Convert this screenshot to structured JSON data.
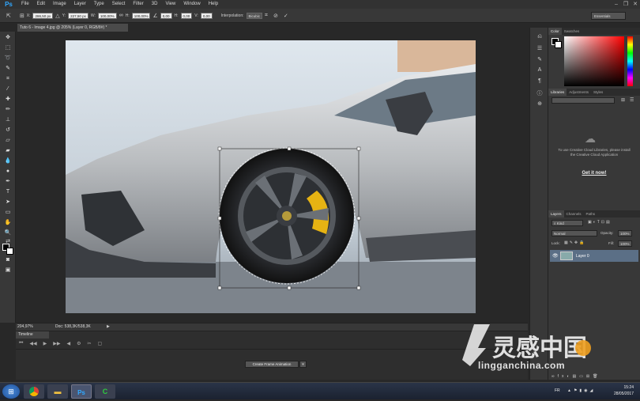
{
  "app": {
    "logo": "Ps"
  },
  "menu": [
    "File",
    "Edit",
    "Image",
    "Layer",
    "Type",
    "Select",
    "Filter",
    "3D",
    "View",
    "Window",
    "Help"
  ],
  "window_controls": [
    "–",
    "❐",
    "✕"
  ],
  "options_bar": {
    "x_label": "X:",
    "x_value": "286,50 px",
    "y_label": "Y:",
    "y_value": "227,50 px",
    "w_label": "W:",
    "w_value": "100,00%",
    "h_label": "H:",
    "h_value": "100,00%",
    "angle_value": "0,00",
    "hskew_label": "H:",
    "hskew_value": "0,00",
    "vskew_label": "V:",
    "vskew_value": "0,00",
    "interp_label": "Interpolation:",
    "interp_value": "Bicubic",
    "workspace": "Essentials"
  },
  "document_tab": "Tuto 6 - Image 4.jpg @ 205% (Layer 0, RGB/8#) *",
  "status": {
    "zoom": "204,97%",
    "doc": "Doc: 538,3K/538,3K"
  },
  "timeline": {
    "title": "Timeline",
    "create_button": "Create Frame Animation"
  },
  "panels": {
    "color_tabs": [
      "Color",
      "Swatches"
    ],
    "lib_tabs": [
      "Libraries",
      "Adjustments",
      "Styles"
    ],
    "lib_message": "To use Creative Cloud Libraries, please install the Creative Cloud Application",
    "lib_link": "Get it now!",
    "layer_tabs": [
      "Layers",
      "Channels",
      "Paths"
    ],
    "filter_kind": "Kind",
    "blend_mode": "Normal",
    "opacity_label": "Opacity:",
    "opacity_value": "100%",
    "lock_label": "Lock:",
    "fill_label": "Fill:",
    "fill_value": "100%",
    "layer_name": "Layer 0"
  },
  "watermark": {
    "cn": "灵感中国",
    "url": "lingganchina.com"
  },
  "taskbar": {
    "lang": "FR",
    "time": "15:24",
    "date": "28/05/2017"
  },
  "colors": {
    "accent": "#31a8ff",
    "selection": "#5b6f86"
  }
}
